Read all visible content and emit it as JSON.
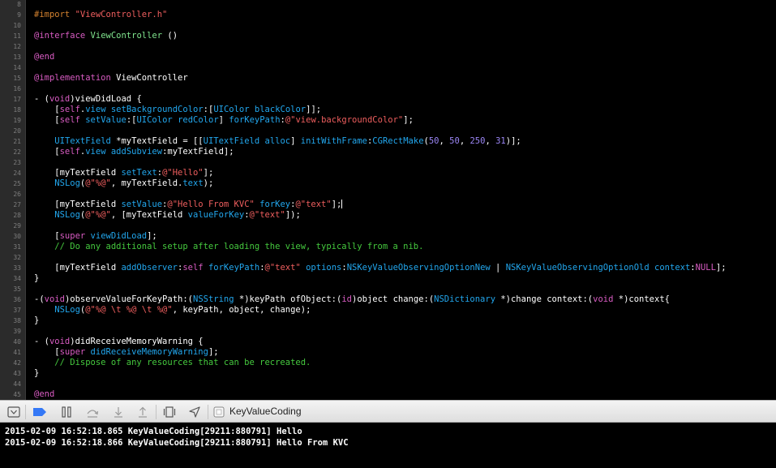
{
  "editor": {
    "lines": [
      {
        "n": "8",
        "tokens": []
      },
      {
        "n": "9",
        "tokens": [
          {
            "t": "#import ",
            "c": "pp"
          },
          {
            "t": "\"ViewController.h\"",
            "c": "str"
          }
        ]
      },
      {
        "n": "10",
        "tokens": []
      },
      {
        "n": "11",
        "tokens": [
          {
            "t": "@interface",
            "c": "kw"
          },
          {
            "t": " ",
            "c": "plain"
          },
          {
            "t": "ViewController",
            "c": "decl"
          },
          {
            "t": " ()",
            "c": "plain"
          }
        ]
      },
      {
        "n": "12",
        "tokens": []
      },
      {
        "n": "13",
        "tokens": [
          {
            "t": "@end",
            "c": "kw"
          }
        ]
      },
      {
        "n": "14",
        "tokens": []
      },
      {
        "n": "15",
        "tokens": [
          {
            "t": "@implementation",
            "c": "kw"
          },
          {
            "t": " ViewController",
            "c": "plain"
          }
        ]
      },
      {
        "n": "16",
        "tokens": []
      },
      {
        "n": "17",
        "tokens": [
          {
            "t": "- (",
            "c": "plain"
          },
          {
            "t": "void",
            "c": "kw"
          },
          {
            "t": ")viewDidLoad {",
            "c": "plain"
          }
        ]
      },
      {
        "n": "18",
        "tokens": [
          {
            "t": "    [",
            "c": "plain"
          },
          {
            "t": "self",
            "c": "kw"
          },
          {
            "t": ".",
            "c": "plain"
          },
          {
            "t": "view",
            "c": "mth"
          },
          {
            "t": " ",
            "c": "plain"
          },
          {
            "t": "setBackgroundColor",
            "c": "mth"
          },
          {
            "t": ":[",
            "c": "plain"
          },
          {
            "t": "UIColor",
            "c": "cls"
          },
          {
            "t": " ",
            "c": "plain"
          },
          {
            "t": "blackColor",
            "c": "mth"
          },
          {
            "t": "]];",
            "c": "plain"
          }
        ]
      },
      {
        "n": "19",
        "tokens": [
          {
            "t": "    [",
            "c": "plain"
          },
          {
            "t": "self",
            "c": "kw"
          },
          {
            "t": " ",
            "c": "plain"
          },
          {
            "t": "setValue",
            "c": "mth"
          },
          {
            "t": ":[",
            "c": "plain"
          },
          {
            "t": "UIColor",
            "c": "cls"
          },
          {
            "t": " ",
            "c": "plain"
          },
          {
            "t": "redColor",
            "c": "mth"
          },
          {
            "t": "] ",
            "c": "plain"
          },
          {
            "t": "forKeyPath",
            "c": "mth"
          },
          {
            "t": ":",
            "c": "plain"
          },
          {
            "t": "@\"view.backgroundColor\"",
            "c": "str"
          },
          {
            "t": "];",
            "c": "plain"
          }
        ]
      },
      {
        "n": "20",
        "tokens": []
      },
      {
        "n": "21",
        "tokens": [
          {
            "t": "    ",
            "c": "plain"
          },
          {
            "t": "UITextField",
            "c": "cls"
          },
          {
            "t": " *myTextField = [[",
            "c": "plain"
          },
          {
            "t": "UITextField",
            "c": "cls"
          },
          {
            "t": " ",
            "c": "plain"
          },
          {
            "t": "alloc",
            "c": "mth"
          },
          {
            "t": "] ",
            "c": "plain"
          },
          {
            "t": "initWithFrame",
            "c": "mth"
          },
          {
            "t": ":",
            "c": "plain"
          },
          {
            "t": "CGRectMake",
            "c": "mth"
          },
          {
            "t": "(",
            "c": "plain"
          },
          {
            "t": "50",
            "c": "num"
          },
          {
            "t": ", ",
            "c": "plain"
          },
          {
            "t": "50",
            "c": "num"
          },
          {
            "t": ", ",
            "c": "plain"
          },
          {
            "t": "250",
            "c": "num"
          },
          {
            "t": ", ",
            "c": "plain"
          },
          {
            "t": "31",
            "c": "num"
          },
          {
            "t": ")];",
            "c": "plain"
          }
        ]
      },
      {
        "n": "22",
        "tokens": [
          {
            "t": "    [",
            "c": "plain"
          },
          {
            "t": "self",
            "c": "kw"
          },
          {
            "t": ".",
            "c": "plain"
          },
          {
            "t": "view",
            "c": "mth"
          },
          {
            "t": " ",
            "c": "plain"
          },
          {
            "t": "addSubview",
            "c": "mth"
          },
          {
            "t": ":myTextField];",
            "c": "plain"
          }
        ]
      },
      {
        "n": "23",
        "tokens": []
      },
      {
        "n": "24",
        "tokens": [
          {
            "t": "    [myTextField ",
            "c": "plain"
          },
          {
            "t": "setText",
            "c": "mth"
          },
          {
            "t": ":",
            "c": "plain"
          },
          {
            "t": "@\"Hello\"",
            "c": "str"
          },
          {
            "t": "];",
            "c": "plain"
          }
        ]
      },
      {
        "n": "25",
        "tokens": [
          {
            "t": "    ",
            "c": "plain"
          },
          {
            "t": "NSLog",
            "c": "mth"
          },
          {
            "t": "(",
            "c": "plain"
          },
          {
            "t": "@\"%@\"",
            "c": "str"
          },
          {
            "t": ", myTextField.",
            "c": "plain"
          },
          {
            "t": "text",
            "c": "mth"
          },
          {
            "t": ");",
            "c": "plain"
          }
        ]
      },
      {
        "n": "26",
        "tokens": []
      },
      {
        "n": "27",
        "tokens": [
          {
            "t": "    [myTextField ",
            "c": "plain"
          },
          {
            "t": "setValue",
            "c": "mth"
          },
          {
            "t": ":",
            "c": "plain"
          },
          {
            "t": "@\"Hello From KVC\"",
            "c": "str"
          },
          {
            "t": " ",
            "c": "plain"
          },
          {
            "t": "forKey",
            "c": "mth"
          },
          {
            "t": ":",
            "c": "plain"
          },
          {
            "t": "@\"text\"",
            "c": "str"
          },
          {
            "t": "];",
            "c": "plain"
          },
          {
            "t": "",
            "c": "cursor"
          }
        ]
      },
      {
        "n": "28",
        "tokens": [
          {
            "t": "    ",
            "c": "plain"
          },
          {
            "t": "NSLog",
            "c": "mth"
          },
          {
            "t": "(",
            "c": "plain"
          },
          {
            "t": "@\"%@\"",
            "c": "str"
          },
          {
            "t": ", [myTextField ",
            "c": "plain"
          },
          {
            "t": "valueForKey",
            "c": "mth"
          },
          {
            "t": ":",
            "c": "plain"
          },
          {
            "t": "@\"text\"",
            "c": "str"
          },
          {
            "t": "]);",
            "c": "plain"
          }
        ]
      },
      {
        "n": "29",
        "tokens": []
      },
      {
        "n": "30",
        "tokens": [
          {
            "t": "    [",
            "c": "plain"
          },
          {
            "t": "super",
            "c": "kw"
          },
          {
            "t": " ",
            "c": "plain"
          },
          {
            "t": "viewDidLoad",
            "c": "mth"
          },
          {
            "t": "];",
            "c": "plain"
          }
        ]
      },
      {
        "n": "31",
        "tokens": [
          {
            "t": "    // Do any additional setup after loading the view, typically from a nib.",
            "c": "com"
          }
        ]
      },
      {
        "n": "32",
        "tokens": []
      },
      {
        "n": "33",
        "tokens": [
          {
            "t": "    [myTextField ",
            "c": "plain"
          },
          {
            "t": "addObserver",
            "c": "mth"
          },
          {
            "t": ":",
            "c": "plain"
          },
          {
            "t": "self",
            "c": "kw"
          },
          {
            "t": " ",
            "c": "plain"
          },
          {
            "t": "forKeyPath",
            "c": "mth"
          },
          {
            "t": ":",
            "c": "plain"
          },
          {
            "t": "@\"text\"",
            "c": "str"
          },
          {
            "t": " ",
            "c": "plain"
          },
          {
            "t": "options",
            "c": "mth"
          },
          {
            "t": ":",
            "c": "plain"
          },
          {
            "t": "NSKeyValueObservingOptionNew",
            "c": "cls"
          },
          {
            "t": " | ",
            "c": "plain"
          },
          {
            "t": "NSKeyValueObservingOptionOld",
            "c": "cls"
          },
          {
            "t": " ",
            "c": "plain"
          },
          {
            "t": "context",
            "c": "mth"
          },
          {
            "t": ":",
            "c": "plain"
          },
          {
            "t": "NULL",
            "c": "kw"
          },
          {
            "t": "];",
            "c": "plain"
          }
        ]
      },
      {
        "n": "34",
        "tokens": [
          {
            "t": "}",
            "c": "plain"
          }
        ]
      },
      {
        "n": "35",
        "tokens": []
      },
      {
        "n": "36",
        "tokens": [
          {
            "t": "-(",
            "c": "plain"
          },
          {
            "t": "void",
            "c": "kw"
          },
          {
            "t": ")observeValueForKeyPath:(",
            "c": "plain"
          },
          {
            "t": "NSString",
            "c": "cls"
          },
          {
            "t": " *)keyPath ofObject:(",
            "c": "plain"
          },
          {
            "t": "id",
            "c": "kw"
          },
          {
            "t": ")object change:(",
            "c": "plain"
          },
          {
            "t": "NSDictionary",
            "c": "cls"
          },
          {
            "t": " *)change context:(",
            "c": "plain"
          },
          {
            "t": "void",
            "c": "kw"
          },
          {
            "t": " *)context{",
            "c": "plain"
          }
        ]
      },
      {
        "n": "37",
        "tokens": [
          {
            "t": "    ",
            "c": "plain"
          },
          {
            "t": "NSLog",
            "c": "mth"
          },
          {
            "t": "(",
            "c": "plain"
          },
          {
            "t": "@\"%@ \\t %@ \\t %@\"",
            "c": "str"
          },
          {
            "t": ", keyPath, object, change);",
            "c": "plain"
          }
        ]
      },
      {
        "n": "38",
        "tokens": [
          {
            "t": "}",
            "c": "plain"
          }
        ]
      },
      {
        "n": "39",
        "tokens": []
      },
      {
        "n": "40",
        "tokens": [
          {
            "t": "- (",
            "c": "plain"
          },
          {
            "t": "void",
            "c": "kw"
          },
          {
            "t": ")didReceiveMemoryWarning {",
            "c": "plain"
          }
        ]
      },
      {
        "n": "41",
        "tokens": [
          {
            "t": "    [",
            "c": "plain"
          },
          {
            "t": "super",
            "c": "kw"
          },
          {
            "t": " ",
            "c": "plain"
          },
          {
            "t": "didReceiveMemoryWarning",
            "c": "mth"
          },
          {
            "t": "];",
            "c": "plain"
          }
        ]
      },
      {
        "n": "42",
        "tokens": [
          {
            "t": "    // Dispose of any resources that can be recreated.",
            "c": "com"
          }
        ]
      },
      {
        "n": "43",
        "tokens": [
          {
            "t": "}",
            "c": "plain"
          }
        ]
      },
      {
        "n": "44",
        "tokens": []
      },
      {
        "n": "45",
        "tokens": [
          {
            "t": "@end",
            "c": "kw"
          }
        ]
      }
    ]
  },
  "debug_bar": {
    "buttons": [
      {
        "name": "hide-debug-area-button",
        "icon": "hide-debug-area-icon"
      },
      {
        "name": "breakpoints-toggle-button",
        "icon": "breakpoint-icon"
      },
      {
        "name": "pause-button",
        "icon": "pause-icon"
      },
      {
        "name": "step-over-button",
        "icon": "step-over-icon"
      },
      {
        "name": "step-into-button",
        "icon": "step-into-icon"
      },
      {
        "name": "step-out-button",
        "icon": "step-out-icon"
      },
      {
        "name": "view-debugger-button",
        "icon": "view-hierarchy-icon"
      },
      {
        "name": "simulate-location-button",
        "icon": "location-icon"
      },
      {
        "name": "process-selector-button",
        "icon": "app-icon"
      }
    ],
    "process_label": "KeyValueCoding"
  },
  "console": {
    "lines": [
      "2015-02-09 16:52:18.865 KeyValueCoding[29211:880791] Hello",
      "2015-02-09 16:52:18.866 KeyValueCoding[29211:880791] Hello From KVC"
    ]
  },
  "colors": {
    "keyword": "#d95cc3",
    "preprocessor": "#d4822f",
    "string": "#ee5e5e",
    "class": "#22a7ee",
    "comment": "#45c93e",
    "number": "#9b86f5",
    "breakpoint_active": "#3478f6"
  }
}
